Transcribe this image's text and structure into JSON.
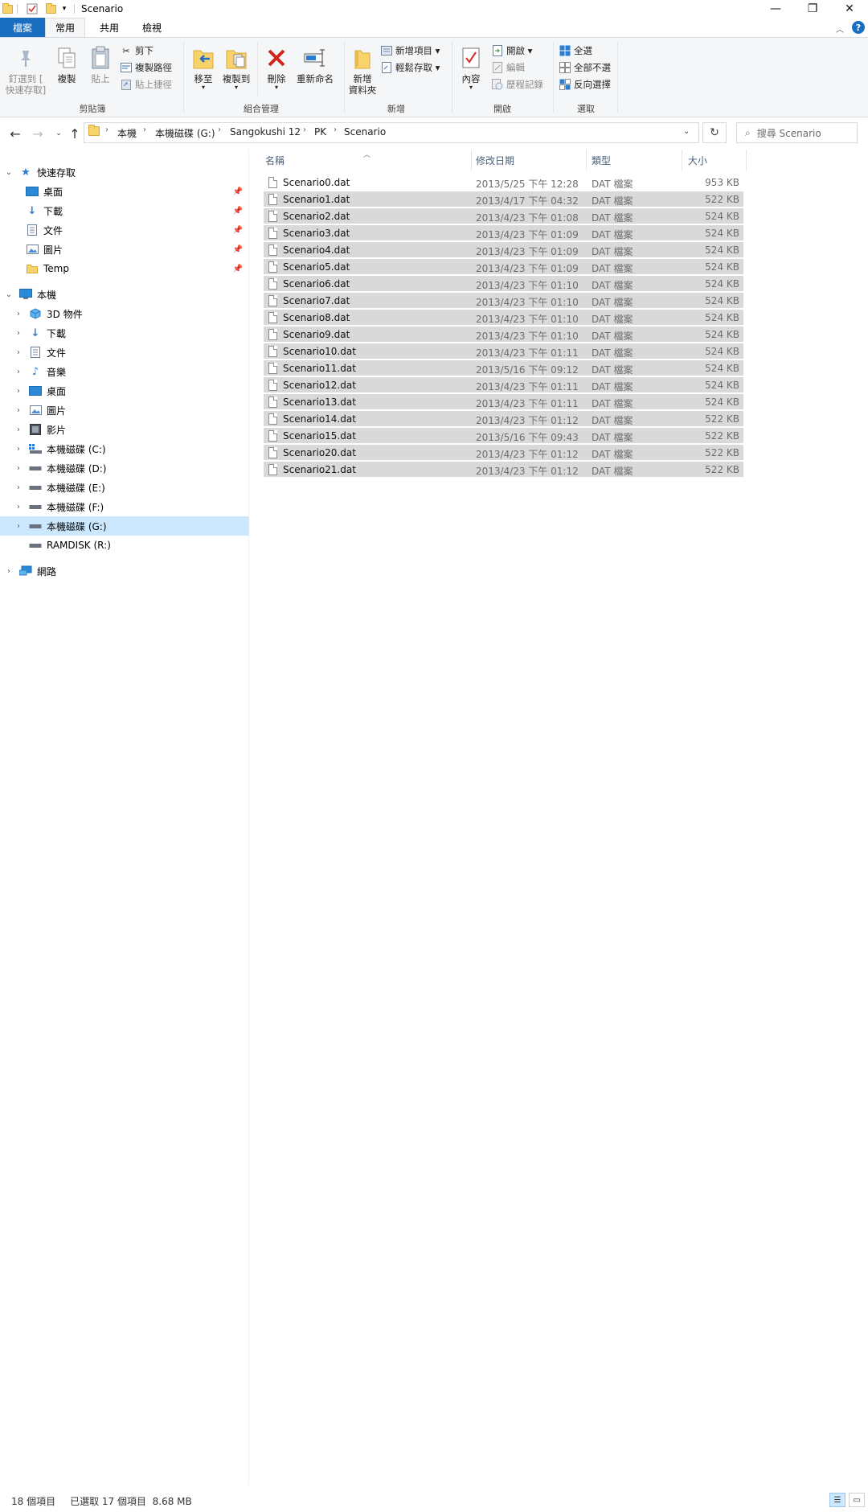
{
  "window": {
    "title": "Scenario",
    "buttons": {
      "minimize": "—",
      "restore": "❐",
      "close": "✕"
    }
  },
  "ribbon": {
    "tabs": [
      "檔案",
      "常用",
      "共用",
      "檢視"
    ],
    "help": "?",
    "groups": {
      "clipboard": {
        "label": "剪貼簿",
        "pin_quick": "釘選到 [\n快速存取]",
        "copy": "複製",
        "paste": "貼上",
        "cut": "剪下",
        "copy_path": "複製路徑",
        "paste_shortcut": "貼上捷徑"
      },
      "organize": {
        "label": "組合管理",
        "move_to": "移至",
        "copy_to": "複製到",
        "delete": "刪除",
        "rename": "重新命名"
      },
      "new": {
        "label": "新增",
        "new_folder": "新增\n資料夾",
        "new_item": "新增項目 ▾",
        "easy_access": "輕鬆存取 ▾"
      },
      "open": {
        "label": "開啟",
        "properties": "內容",
        "open": "開啟 ▾",
        "edit": "編輯",
        "history": "歷程記錄"
      },
      "select": {
        "label": "選取",
        "select_all": "全選",
        "select_none": "全部不選",
        "invert": "反向選擇"
      }
    }
  },
  "address": {
    "breadcrumb": [
      "本機",
      "本機磁碟 (G:)",
      "Sangokushi 12",
      "PK",
      "Scenario"
    ],
    "search_placeholder": "搜尋 Scenario"
  },
  "nav": {
    "quick_access": "快速存取",
    "quick_items": [
      "桌面",
      "下載",
      "文件",
      "圖片",
      "Temp"
    ],
    "this_pc": "本機",
    "pc_items": [
      "3D 物件",
      "下載",
      "文件",
      "音樂",
      "桌面",
      "圖片",
      "影片",
      "本機磁碟 (C:)",
      "本機磁碟 (D:)",
      "本機磁碟 (E:)",
      "本機磁碟 (F:)",
      "本機磁碟 (G:)",
      "RAMDISK (R:)"
    ],
    "network": "網路"
  },
  "files": {
    "columns": {
      "name": "名稱",
      "date": "修改日期",
      "type": "類型",
      "size": "大小"
    },
    "rows": [
      {
        "name": "Scenario0.dat",
        "date": "2013/5/25 下午 12:28",
        "type": "DAT 檔案",
        "size": "953 KB",
        "selected": false
      },
      {
        "name": "Scenario1.dat",
        "date": "2013/4/17 下午 04:32",
        "type": "DAT 檔案",
        "size": "522 KB",
        "selected": true
      },
      {
        "name": "Scenario2.dat",
        "date": "2013/4/23 下午 01:08",
        "type": "DAT 檔案",
        "size": "524 KB",
        "selected": true
      },
      {
        "name": "Scenario3.dat",
        "date": "2013/4/23 下午 01:09",
        "type": "DAT 檔案",
        "size": "524 KB",
        "selected": true
      },
      {
        "name": "Scenario4.dat",
        "date": "2013/4/23 下午 01:09",
        "type": "DAT 檔案",
        "size": "524 KB",
        "selected": true
      },
      {
        "name": "Scenario5.dat",
        "date": "2013/4/23 下午 01:09",
        "type": "DAT 檔案",
        "size": "524 KB",
        "selected": true
      },
      {
        "name": "Scenario6.dat",
        "date": "2013/4/23 下午 01:10",
        "type": "DAT 檔案",
        "size": "524 KB",
        "selected": true
      },
      {
        "name": "Scenario7.dat",
        "date": "2013/4/23 下午 01:10",
        "type": "DAT 檔案",
        "size": "524 KB",
        "selected": true
      },
      {
        "name": "Scenario8.dat",
        "date": "2013/4/23 下午 01:10",
        "type": "DAT 檔案",
        "size": "524 KB",
        "selected": true
      },
      {
        "name": "Scenario9.dat",
        "date": "2013/4/23 下午 01:10",
        "type": "DAT 檔案",
        "size": "524 KB",
        "selected": true
      },
      {
        "name": "Scenario10.dat",
        "date": "2013/4/23 下午 01:11",
        "type": "DAT 檔案",
        "size": "524 KB",
        "selected": true
      },
      {
        "name": "Scenario11.dat",
        "date": "2013/5/16 下午 09:12",
        "type": "DAT 檔案",
        "size": "524 KB",
        "selected": true
      },
      {
        "name": "Scenario12.dat",
        "date": "2013/4/23 下午 01:11",
        "type": "DAT 檔案",
        "size": "524 KB",
        "selected": true
      },
      {
        "name": "Scenario13.dat",
        "date": "2013/4/23 下午 01:11",
        "type": "DAT 檔案",
        "size": "524 KB",
        "selected": true
      },
      {
        "name": "Scenario14.dat",
        "date": "2013/4/23 下午 01:12",
        "type": "DAT 檔案",
        "size": "522 KB",
        "selected": true
      },
      {
        "name": "Scenario15.dat",
        "date": "2013/5/16 下午 09:43",
        "type": "DAT 檔案",
        "size": "522 KB",
        "selected": true
      },
      {
        "name": "Scenario20.dat",
        "date": "2013/4/23 下午 01:12",
        "type": "DAT 檔案",
        "size": "522 KB",
        "selected": true
      },
      {
        "name": "Scenario21.dat",
        "date": "2013/4/23 下午 01:12",
        "type": "DAT 檔案",
        "size": "522 KB",
        "selected": true
      }
    ]
  },
  "status": {
    "item_count": "18 個項目",
    "selected": "已選取 17 個項目  8.68 MB"
  },
  "colors": {
    "accent": "#1a6ec0",
    "selection": "#cce8ff",
    "row_selected": "#d9d9d9"
  }
}
